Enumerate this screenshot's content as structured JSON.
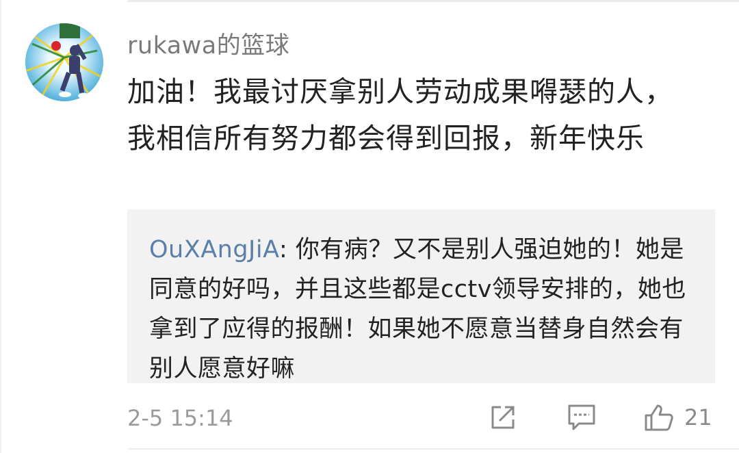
{
  "comment": {
    "username": "rukawa的篮球",
    "text": "加油！我最讨厌拿别人劳动成果嘚瑟的人，我相信所有努力都会得到回报，新年快乐",
    "reply": {
      "username": "OuXAngJiA",
      "separator": ": ",
      "text": "你有病？又不是别人强迫她的！她是同意的好吗，并且这些都是cctv领导安排的，她也拿到了应得的报酬！如果她不愿意当替身自然会有别人愿意好嘛"
    },
    "timestamp": "2-5 15:14",
    "actions": {
      "share_icon": "share-icon",
      "comment_icon": "comment-icon",
      "like_icon": "thumbs-up-icon",
      "like_count": "21"
    }
  },
  "colors": {
    "username": "#7a7a7a",
    "reply_username": "#5b7fa8",
    "body_text": "#222222",
    "reply_bg": "#f2f2f2",
    "meta": "#9a9a9a"
  }
}
